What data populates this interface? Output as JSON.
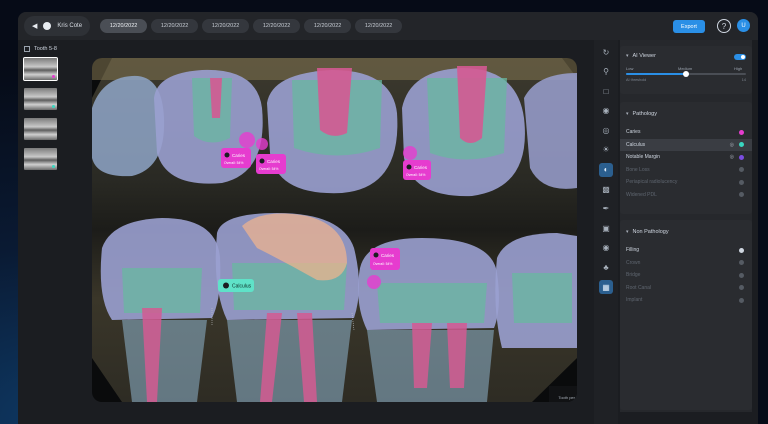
{
  "patient": {
    "name": "Kris Cote",
    "back_icon": "chevron-left-icon",
    "avatar_icon": "user-icon"
  },
  "date_tabs": [
    {
      "label": "12/20/2022",
      "active": true
    },
    {
      "label": "12/20/2022",
      "active": false
    },
    {
      "label": "12/20/2022",
      "active": false
    },
    {
      "label": "12/20/2022",
      "active": false
    },
    {
      "label": "12/20/2022",
      "active": false
    },
    {
      "label": "12/20/2022",
      "active": false
    }
  ],
  "header": {
    "export_label": "Export",
    "help_label": "?",
    "user_initial": "U"
  },
  "thumbnails": {
    "title": "Tooth 5-8",
    "count": 4
  },
  "viewer": {
    "corner_label": "Tooth per",
    "annotations": [
      {
        "label": "Caries",
        "detail": "Overall: 54%",
        "kind": "caries"
      },
      {
        "label": "Caries",
        "detail": "Overall: 54%",
        "kind": "caries"
      },
      {
        "label": "Caries",
        "detail": "Overall: 54%",
        "kind": "caries"
      },
      {
        "label": "Caries",
        "detail": "Overall: 54%",
        "kind": "caries"
      },
      {
        "label": "Calculus",
        "detail": "",
        "kind": "calculus"
      }
    ]
  },
  "ai_viewer": {
    "title": "AI Viewer",
    "enabled": true,
    "slider_labels": [
      "Low",
      "Medium",
      "High"
    ],
    "slider_value": 0.5,
    "slider_sub_left": "AI threshold",
    "slider_sub_right": "14"
  },
  "pathology": {
    "title": "Pathology",
    "items": [
      {
        "label": "Caries",
        "color": "#e63ccf",
        "state": "normal"
      },
      {
        "label": "Calculus",
        "color": "#39d6c0",
        "state": "selected"
      },
      {
        "label": "Notable Margin",
        "color": "#7b4de0",
        "state": "normal"
      },
      {
        "label": "Bone Loss",
        "color": "#555b63",
        "state": "dim"
      },
      {
        "label": "Periapical radiolucency",
        "color": "#555b63",
        "state": "dim"
      },
      {
        "label": "Widened PDL",
        "color": "#555b63",
        "state": "dim"
      }
    ]
  },
  "non_pathology": {
    "title": "Non Pathology",
    "items": [
      {
        "label": "Filling",
        "state": "normal"
      },
      {
        "label": "Crown",
        "state": "dim"
      },
      {
        "label": "Bridge",
        "state": "dim"
      },
      {
        "label": "Root Canal",
        "state": "dim"
      },
      {
        "label": "Implant",
        "state": "dim"
      }
    ]
  },
  "tools": [
    "rotate-icon",
    "zoom-icon",
    "crop-icon",
    "eye-icon",
    "visibility-icon",
    "brightness-icon",
    "contrast-icon",
    "image-icon",
    "draw-icon",
    "frame-icon",
    "capture-icon",
    "tooth-icon",
    "grid-icon"
  ]
}
